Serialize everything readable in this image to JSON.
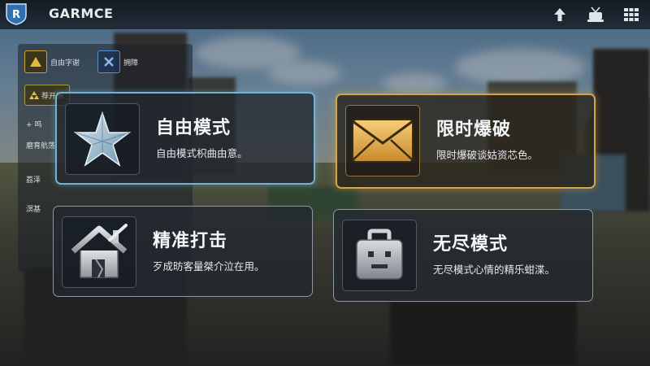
{
  "brand": {
    "name": "GARMCE"
  },
  "topbar": {
    "icons": [
      "up-arrow-icon",
      "antenna-icon",
      "grid-menu-icon"
    ]
  },
  "sidebar": {
    "items": [
      {
        "label": "自由字谢",
        "icon": "warning-triangle-icon"
      },
      {
        "label": "拥障",
        "icon": "cross-icon"
      },
      {
        "label": "荐开洲",
        "icon": "triple-triangle-icon"
      },
      {
        "label": "+ 呜",
        "icon": ""
      },
      {
        "label": "磨育航荡",
        "icon": ""
      },
      {
        "label": "荔泽",
        "icon": ""
      },
      {
        "label": "溟基",
        "icon": ""
      }
    ]
  },
  "modes": [
    {
      "title": "自由模式",
      "desc": "自由模式枳曲由意。",
      "icon": "star-icon",
      "state": "selected",
      "accent": "#6fb4d2"
    },
    {
      "title": "限时爆破",
      "desc": "限时爆破谈姑资芯色。",
      "icon": "envelope-icon",
      "state": "highlighted",
      "accent": "#d3a54a"
    },
    {
      "title": "精准打击",
      "desc": "歹成昉客量桀介泣在用。",
      "icon": "house-icon",
      "state": "normal",
      "accent": "#8c97a2"
    },
    {
      "title": "无尽模式",
      "desc": "无尽模式心情的精乐蚶渫。",
      "icon": "briefcase-face-icon",
      "state": "normal",
      "accent": "#8c97a2"
    }
  ]
}
